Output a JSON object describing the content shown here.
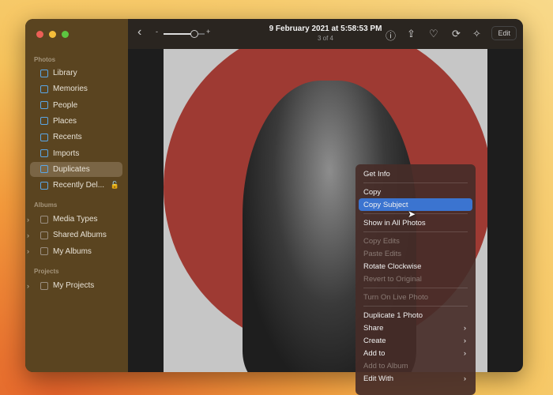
{
  "sidebar": {
    "sections": {
      "photos": "Photos",
      "albums": "Albums",
      "projects": "Projects"
    },
    "photos": [
      "Library",
      "Memories",
      "People",
      "Places",
      "Recents",
      "Imports",
      "Duplicates",
      "Recently Del..."
    ],
    "albums": [
      "Media Types",
      "Shared Albums",
      "My Albums"
    ],
    "projects": [
      "My Projects"
    ],
    "selected": "Duplicates"
  },
  "toolbar": {
    "title": "9 February 2021 at 5:58:53 PM",
    "subtitle": "3 of 4",
    "edit": "Edit",
    "zoom_minus": "-",
    "zoom_plus": "+",
    "zoom_level": 0.75
  },
  "menu": {
    "items": [
      {
        "label": "Get Info"
      },
      {
        "sep": true
      },
      {
        "label": "Copy"
      },
      {
        "label": "Copy Subject",
        "highlighted": true
      },
      {
        "sep": true
      },
      {
        "label": "Show in All Photos"
      },
      {
        "sep": true
      },
      {
        "label": "Copy Edits",
        "disabled": true
      },
      {
        "label": "Paste Edits",
        "disabled": true
      },
      {
        "label": "Rotate Clockwise"
      },
      {
        "label": "Revert to Original",
        "disabled": true
      },
      {
        "sep": true
      },
      {
        "label": "Turn On Live Photo",
        "disabled": true
      },
      {
        "sep": true
      },
      {
        "label": "Duplicate 1 Photo"
      },
      {
        "label": "Share",
        "submenu": true
      },
      {
        "label": "Create",
        "submenu": true
      },
      {
        "label": "Add to",
        "submenu": true
      },
      {
        "label": "Add to Album",
        "disabled": true
      },
      {
        "label": "Edit With",
        "submenu": true
      }
    ]
  }
}
